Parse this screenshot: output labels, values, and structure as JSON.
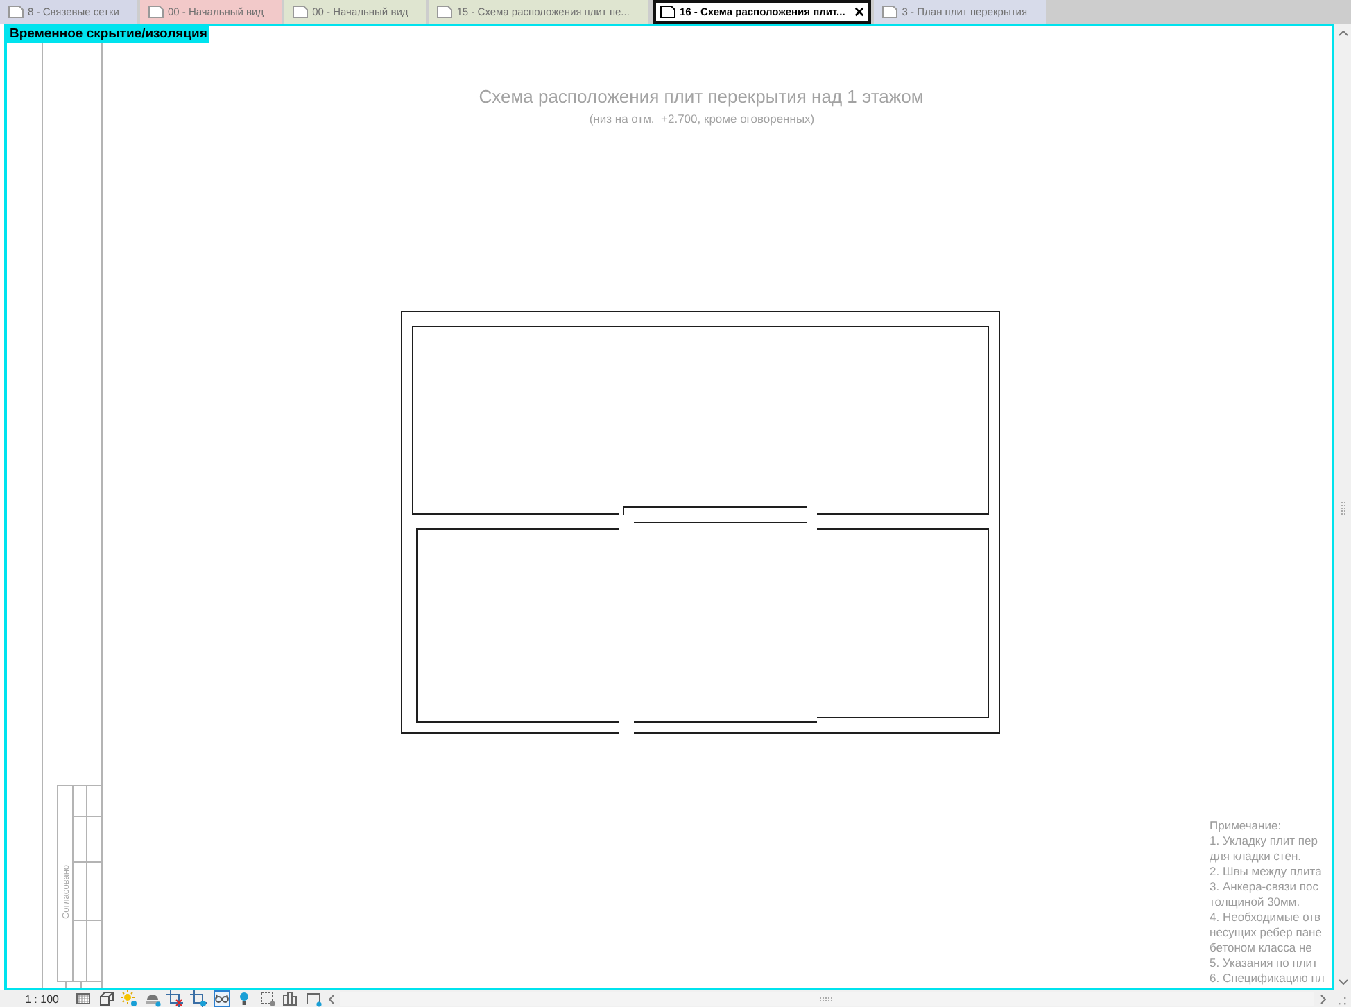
{
  "tabs": [
    {
      "label": "8 - Связевые сетки",
      "selected": false,
      "color": "#d4d7e8"
    },
    {
      "label": "00 - Начальный вид",
      "selected": false,
      "color": "#f2c9c9"
    },
    {
      "label": "00 - Начальный вид",
      "selected": false,
      "color": "#dfe5d0"
    },
    {
      "label": "15 - Схема расположения плит пе...",
      "selected": false,
      "color": "#dfe5d0"
    },
    {
      "label": "16 - Схема расположения плит...",
      "selected": true,
      "color": "#ffffff"
    },
    {
      "label": "3 - План плит перекрытия",
      "selected": false,
      "color": "#d7dbea"
    }
  ],
  "view": {
    "badge": "Временное скрытие/изоляция",
    "title": "Схема расположения плит перекрытия над 1 этажом",
    "subtitle": "(низ на отм.  +2.700, кроме оговоренных)",
    "stamp_label": "Согласовано",
    "notes": {
      "heading": "Примечание:",
      "items": [
        {
          "lines": [
            "1. Укладку плит пер",
            "для кладки стен."
          ]
        },
        {
          "lines": [
            "2. Швы между плита"
          ]
        },
        {
          "lines": [
            "3. Анкера-связи пос",
            "толщиной 30мм."
          ]
        },
        {
          "lines": [
            "4. Необходимые отв",
            "несущих ребер пане",
            "бетоном класса не"
          ]
        },
        {
          "lines": [
            "5. Указания по плит"
          ]
        },
        {
          "lines": [
            "6. Спецификацию пл"
          ]
        }
      ]
    }
  },
  "status_bar": {
    "scale": "1 : 100",
    "temporary_isolation": true
  }
}
